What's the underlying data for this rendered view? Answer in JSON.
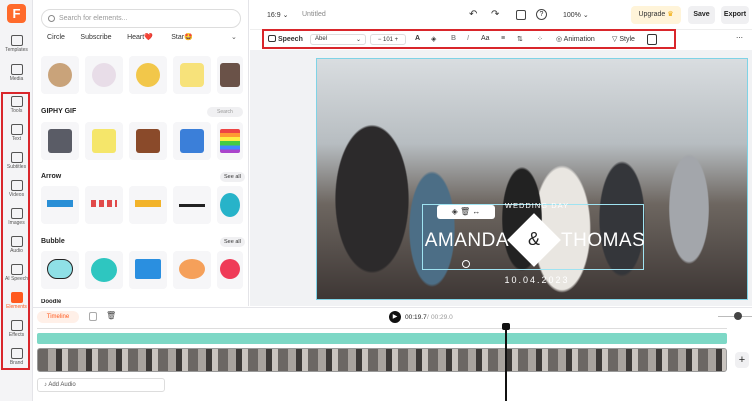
{
  "app": {
    "logo": "F"
  },
  "rail": [
    {
      "label": "Templates",
      "icon": "templates-icon"
    },
    {
      "label": "Media",
      "icon": "media-icon"
    },
    {
      "label": "Tools",
      "icon": "tools-icon"
    },
    {
      "label": "Text",
      "icon": "text-icon"
    },
    {
      "label": "Subtitles",
      "icon": "subtitles-icon"
    },
    {
      "label": "Videos",
      "icon": "videos-icon"
    },
    {
      "label": "Images",
      "icon": "images-icon"
    },
    {
      "label": "Audio",
      "icon": "audio-icon"
    },
    {
      "label": "AI Speech",
      "icon": "ai-speech-icon"
    },
    {
      "label": "Elements",
      "icon": "elements-icon",
      "active": true
    },
    {
      "label": "Effects",
      "icon": "effects-icon"
    },
    {
      "label": "Brand",
      "icon": "brand-icon"
    }
  ],
  "panel": {
    "search_placeholder": "Search for elements...",
    "chips": [
      "Circle",
      "Subscribe",
      "Heart❤️",
      "Star🤩"
    ],
    "giphy": {
      "title": "GIPHY GIF",
      "search_placeholder": "Search"
    },
    "arrow": {
      "title": "Arrow",
      "see_all": "See all"
    },
    "bubble": {
      "title": "Bubble",
      "see_all": "See all"
    },
    "next_section": "Doodle"
  },
  "topbar": {
    "ratio": "16:9",
    "title": "Untitled",
    "zoom": "100%",
    "upgrade": "Upgrade",
    "save": "Save",
    "export": "Export"
  },
  "toolbar": {
    "speech": "Speech",
    "font": "Abel",
    "font_size": "101",
    "animation": "Animation",
    "style": "Style"
  },
  "video_overlay": {
    "heading": "WEDDING DAY",
    "name_left": "AMANDA",
    "ampersand": "&",
    "name_right": "THOMAS",
    "date": "10.04.2023"
  },
  "timeline": {
    "label": "Timeline",
    "time_current": "00:19.7",
    "time_total": "00:29.0",
    "add_audio": "Add Audio"
  },
  "colors": {
    "accent": "#ff5a1f",
    "highlight_box": "#d9262b",
    "text_track": "#7dd8c6"
  }
}
